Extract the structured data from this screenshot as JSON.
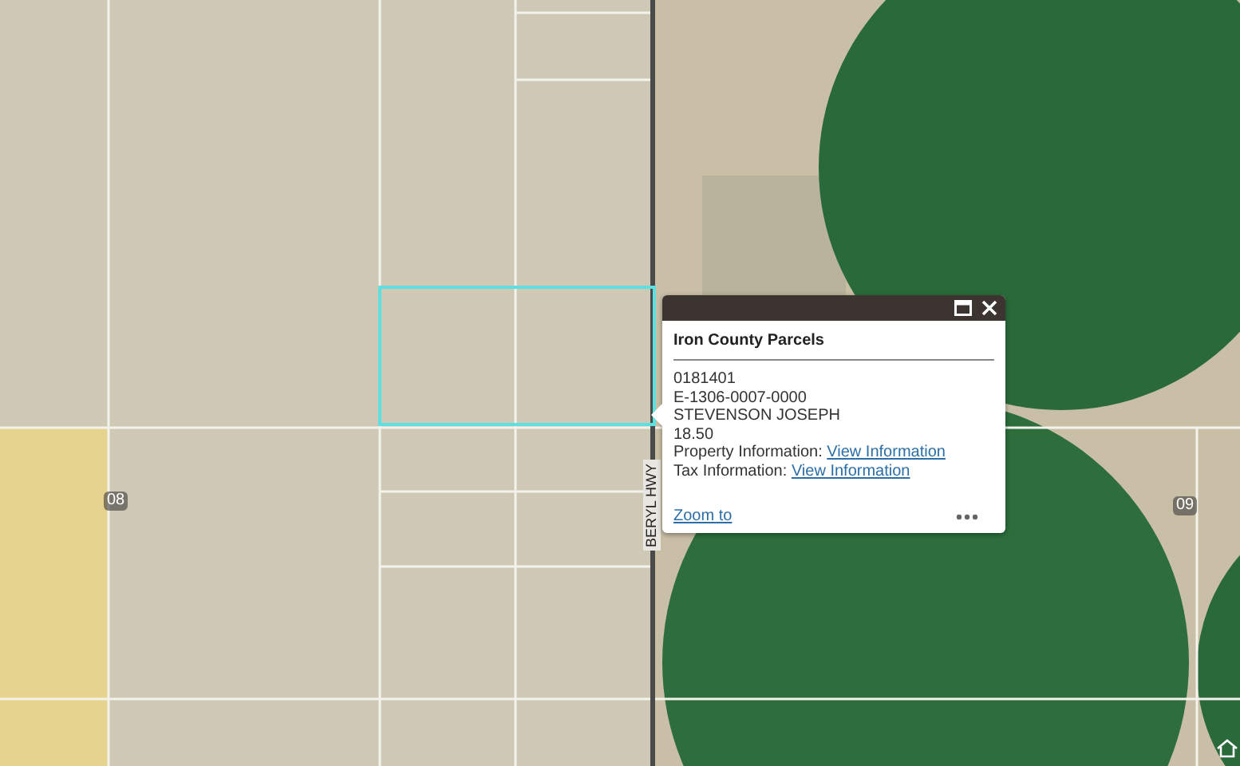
{
  "map": {
    "section_labels": [
      "08",
      "09"
    ],
    "road_label": "BERYL HWY"
  },
  "popup": {
    "title": "Iron County Parcels",
    "lines": [
      "0181401",
      "E-1306-0007-0000",
      "STEVENSON JOSEPH",
      "18.50"
    ],
    "link_rows": [
      {
        "label": "Property Information:",
        "link": "View Information"
      },
      {
        "label": "Tax Information:",
        "link": "View Information"
      }
    ],
    "zoom_link": "Zoom to"
  }
}
